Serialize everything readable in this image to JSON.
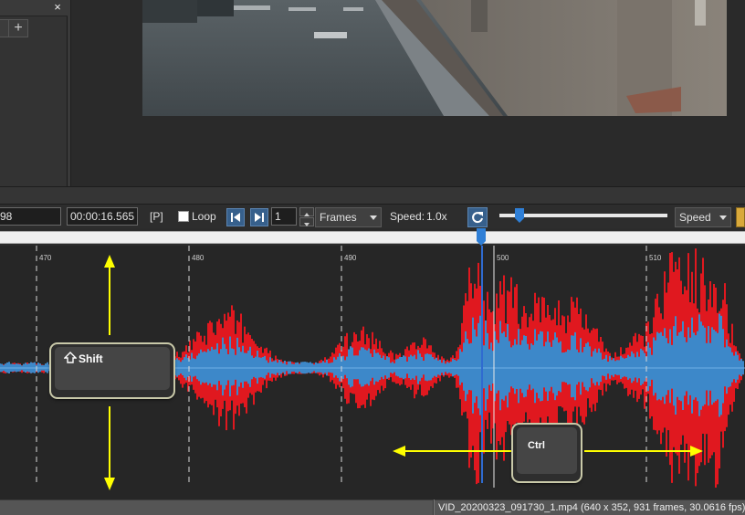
{
  "left_panel": {
    "close_symbol": "×",
    "buttons": [
      "",
      "+"
    ]
  },
  "toolbar": {
    "frame_value": "98",
    "time_value": "00:00:16.565",
    "frame_type": "[P]",
    "loop_label": "Loop",
    "loop_checked": false,
    "step_value": "1",
    "unit_select": "Frames",
    "speed_label": "Speed:",
    "speed_value": "1.0x",
    "speed_select": "Speed",
    "speed_slider_fraction": 0.12
  },
  "scrubber": {
    "position_fraction": 0.646
  },
  "waveform": {
    "frame_ticks": [
      "470",
      "480",
      "490",
      "500",
      "510"
    ],
    "colors": {
      "channel_red": "#e0181f",
      "channel_blue": "#3d88c9",
      "guide": "#ffff00",
      "cursor": "#2f6bd0"
    },
    "keys": {
      "shift_label": "Shift",
      "ctrl_label": "Ctrl"
    }
  },
  "status": {
    "file_info": "VID_20200323_091730_1.mp4 (640 x 352, 931 frames, 30.0616 fps)"
  },
  "icons": {
    "close": "close-icon",
    "prev": "skip-back-icon",
    "next": "skip-forward-icon",
    "refresh": "refresh-icon",
    "shift_arrow": "shift-arrow-icon"
  }
}
